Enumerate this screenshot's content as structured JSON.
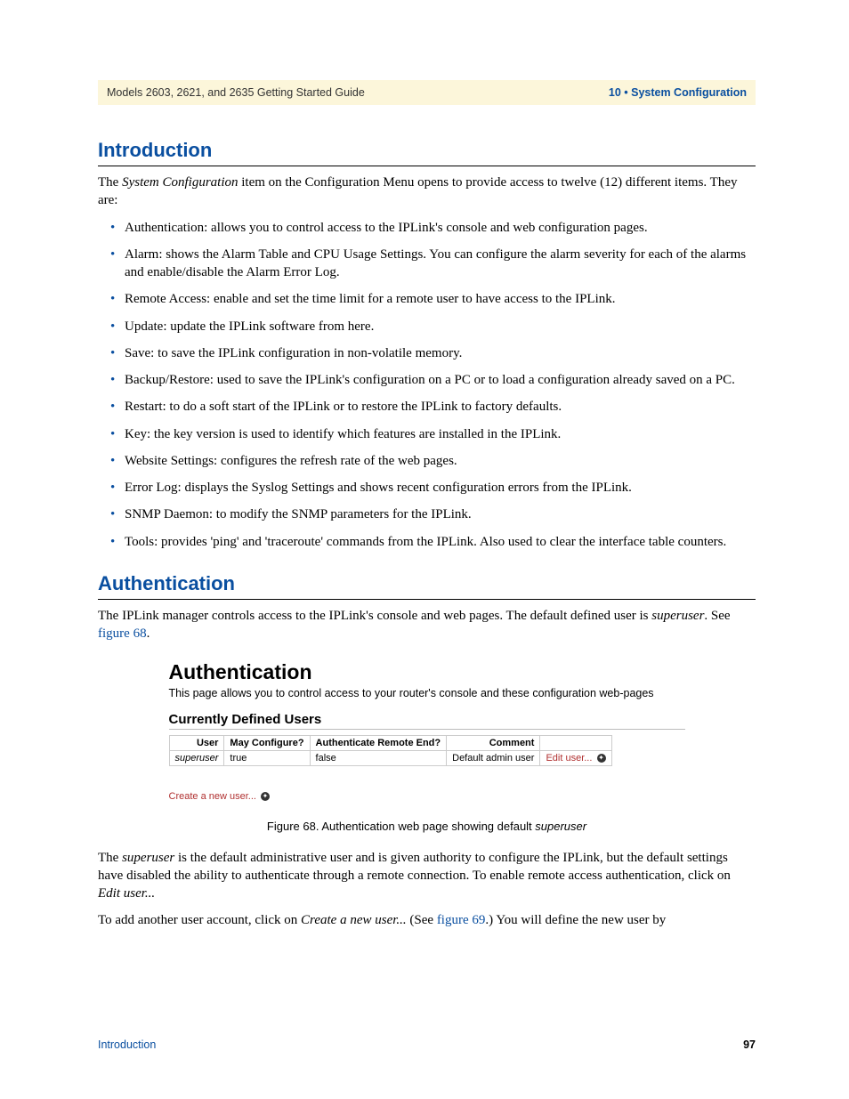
{
  "header": {
    "left": "Models 2603, 2621, and 2635 Getting Started Guide",
    "right": "10 • System Configuration"
  },
  "intro": {
    "title": "Introduction",
    "para_pre": "The ",
    "para_em": "System Configuration",
    "para_post": " item on the Configuration Menu opens to provide access to twelve (12) different items. They are:",
    "bullets": [
      "Authentication: allows you to control access to the IPLink's console and web configuration pages.",
      "Alarm: shows the Alarm Table and CPU Usage Settings. You can configure the alarm severity for each of the alarms and enable/disable the Alarm Error Log.",
      "Remote Access: enable and set the time limit for a remote user to have access to the IPLink.",
      "Update: update the IPLink software from here.",
      "Save: to save the IPLink configuration in non-volatile memory.",
      "Backup/Restore: used to save the IPLink's configuration on a PC or to load a configuration already saved on a PC.",
      "Restart: to do a soft start of the IPLink or to restore the IPLink to factory defaults.",
      "Key: the key version is used to identify which features are installed in the IPLink.",
      "Website Settings: configures the refresh rate of the web pages.",
      "Error Log: displays the Syslog Settings and shows recent configuration errors from the IPLink.",
      "SNMP Daemon: to modify the SNMP parameters for the IPLink.",
      "Tools: provides 'ping' and 'traceroute' commands from the IPLink. Also used to clear the interface table counters."
    ]
  },
  "auth": {
    "title": "Authentication",
    "para_pre": "The IPLink manager controls access to the IPLink's console and web pages. The default defined user is ",
    "para_em": "superuser",
    "para_mid": ". See ",
    "para_link": "figure 68",
    "para_end": "."
  },
  "figure": {
    "title": "Authentication",
    "subtitle": "This page allows you to control access to your router's console and these configuration web-pages",
    "section": "Currently Defined Users",
    "cols": [
      "User",
      "May Configure?",
      "Authenticate Remote End?",
      "Comment",
      ""
    ],
    "row": {
      "user": "superuser",
      "may": "true",
      "auth": "false",
      "comment": "Default admin user",
      "edit": "Edit user..."
    },
    "newuser": "Create a new user...",
    "caption_pre": "Figure 68. Authentication web page showing default ",
    "caption_em": "superuser"
  },
  "post": {
    "p1_pre": "The ",
    "p1_em1": "superuser",
    "p1_mid": " is the default administrative user and is given authority to configure the IPLink, but the default settings have disabled the ability to authenticate through a remote connection. To enable remote access authentication, click on ",
    "p1_em2": "Edit user...",
    "p2_pre": "To add another user account, click on ",
    "p2_em": "Create a new user...",
    "p2_mid": " (See ",
    "p2_link": "figure 69",
    "p2_post": ".) You will define the new user by"
  },
  "footer": {
    "left": "Introduction",
    "right": "97"
  }
}
